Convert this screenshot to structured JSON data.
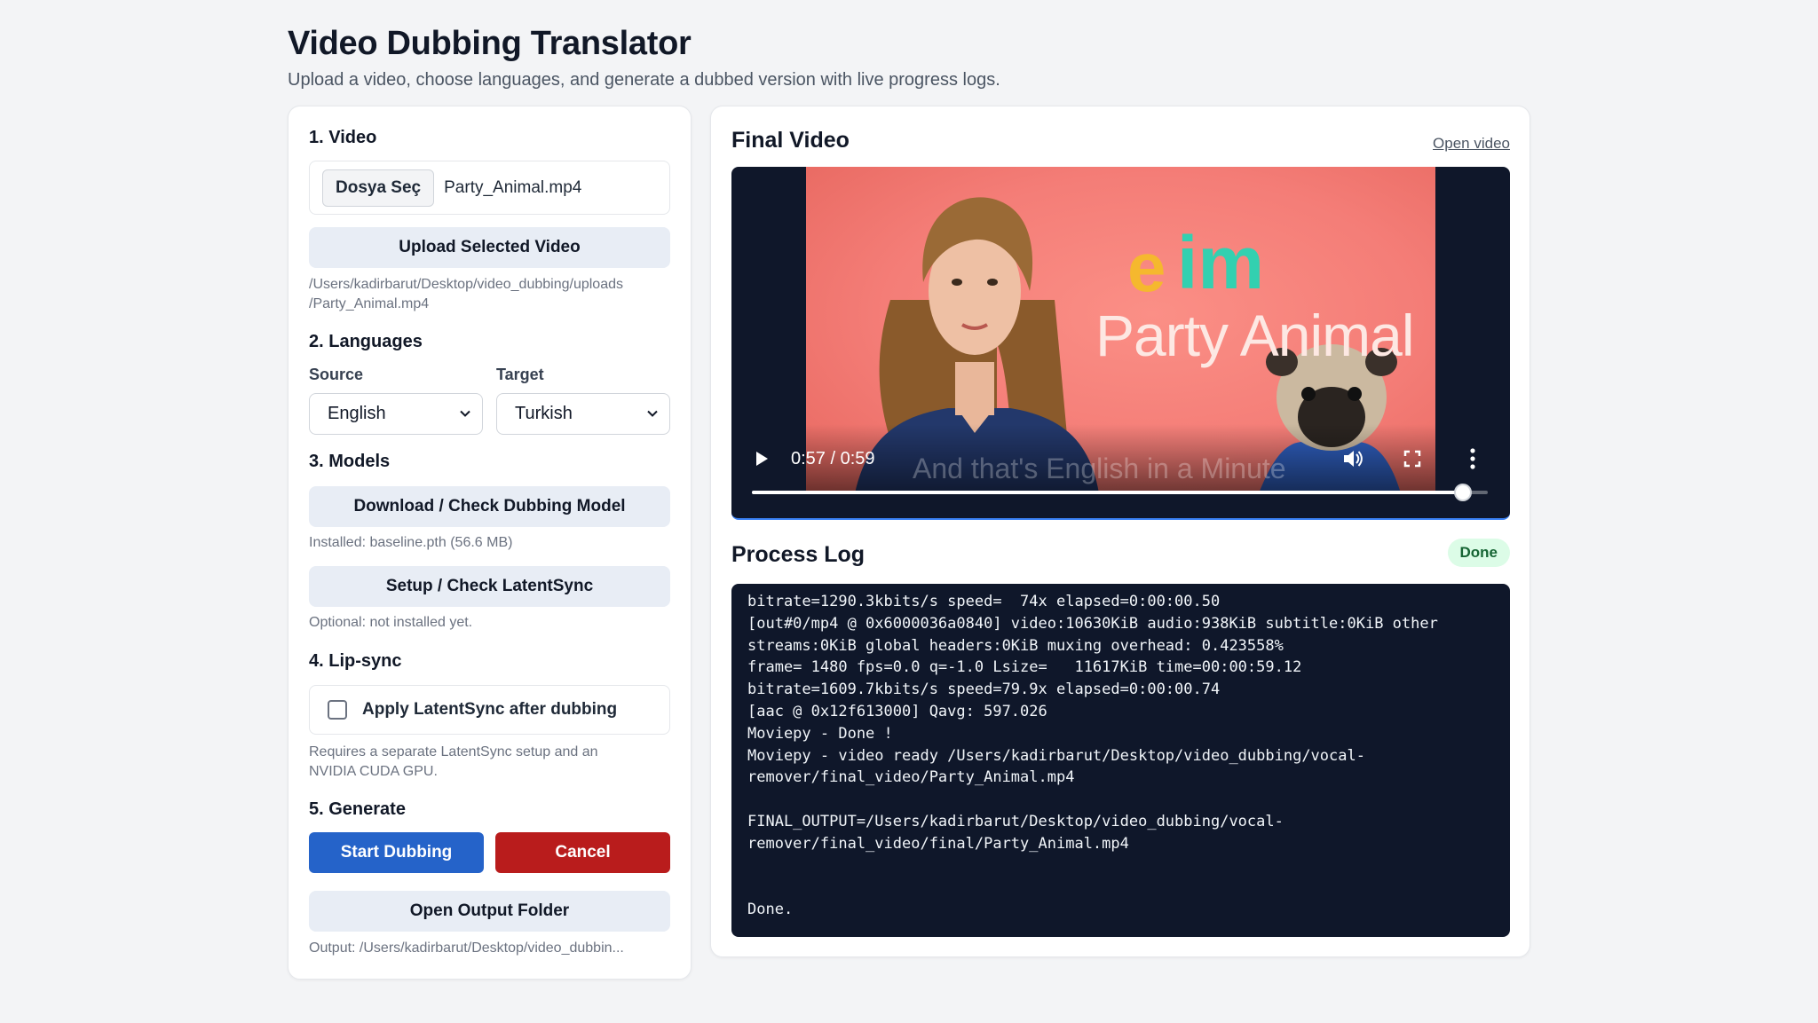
{
  "header": {
    "title": "Video Dubbing Translator",
    "subtitle": "Upload a video, choose languages, and generate a dubbed version with live progress logs."
  },
  "video_section": {
    "title": "1. Video",
    "file_button": "Dosya Seç",
    "file_name": "Party_Animal.mp4",
    "upload_button": "Upload Selected Video",
    "upload_path_line1": "/Users/kadirbarut/Desktop/video_dubbing/uploads",
    "upload_path_line2": "/Party_Animal.mp4"
  },
  "languages": {
    "title": "2. Languages",
    "source_label": "Source",
    "source_value": "English",
    "target_label": "Target",
    "target_value": "Turkish"
  },
  "models": {
    "title": "3. Models",
    "download_button": "Download / Check Dubbing Model",
    "installed_text": "Installed: baseline.pth (56.6 MB)",
    "setup_button": "Setup / Check LatentSync",
    "optional_text": "Optional: not installed yet."
  },
  "lipsync": {
    "title": "4. Lip-sync",
    "checkbox_label": "Apply LatentSync after dubbing",
    "checked": false,
    "note_line1": "Requires a separate LatentSync setup and an",
    "note_line2": "NVIDIA CUDA GPU."
  },
  "generate": {
    "title": "5. Generate",
    "start_button": "Start Dubbing",
    "cancel_button": "Cancel",
    "open_folder_button": "Open Output Folder",
    "output_text": "Output: /Users/kadirbarut/Desktop/video_dubbin..."
  },
  "final_video": {
    "title": "Final Video",
    "open_link": "Open video",
    "time": "0:57 / 0:59",
    "progress": 0.966,
    "overlay_logo_e": "e",
    "overlay_logo_im": "im",
    "overlay_brand": "Party Animal",
    "overlay_caption": "And that's English in a Minute"
  },
  "process_log": {
    "title": "Process Log",
    "status_badge": "Done",
    "lines": [
      "bitrate=1290.3kbits/s speed=  74x elapsed=0:00:00.50",
      "[out#0/mp4 @ 0x6000036a0840] video:10630KiB audio:938KiB subtitle:0KiB other",
      "streams:0KiB global headers:0KiB muxing overhead: 0.423558%",
      "frame= 1480 fps=0.0 q=-1.0 Lsize=   11617KiB time=00:00:59.12",
      "bitrate=1609.7kbits/s speed=79.9x elapsed=0:00:00.74",
      "[aac @ 0x12f613000] Qavg: 597.026",
      "Moviepy - Done !",
      "Moviepy - video ready /Users/kadirbarut/Desktop/video_dubbing/vocal-",
      "remover/final_video/Party_Animal.mp4",
      "",
      "FINAL_OUTPUT=/Users/kadirbarut/Desktop/video_dubbing/vocal-",
      "remover/final_video/final/Party_Animal.mp4",
      "",
      "",
      "Done."
    ]
  },
  "colors": {
    "primary": "#2563c9",
    "danger": "#b91c1c",
    "badge_bg": "#dcfce7",
    "badge_text": "#166534",
    "log_bg": "#0f172a"
  }
}
